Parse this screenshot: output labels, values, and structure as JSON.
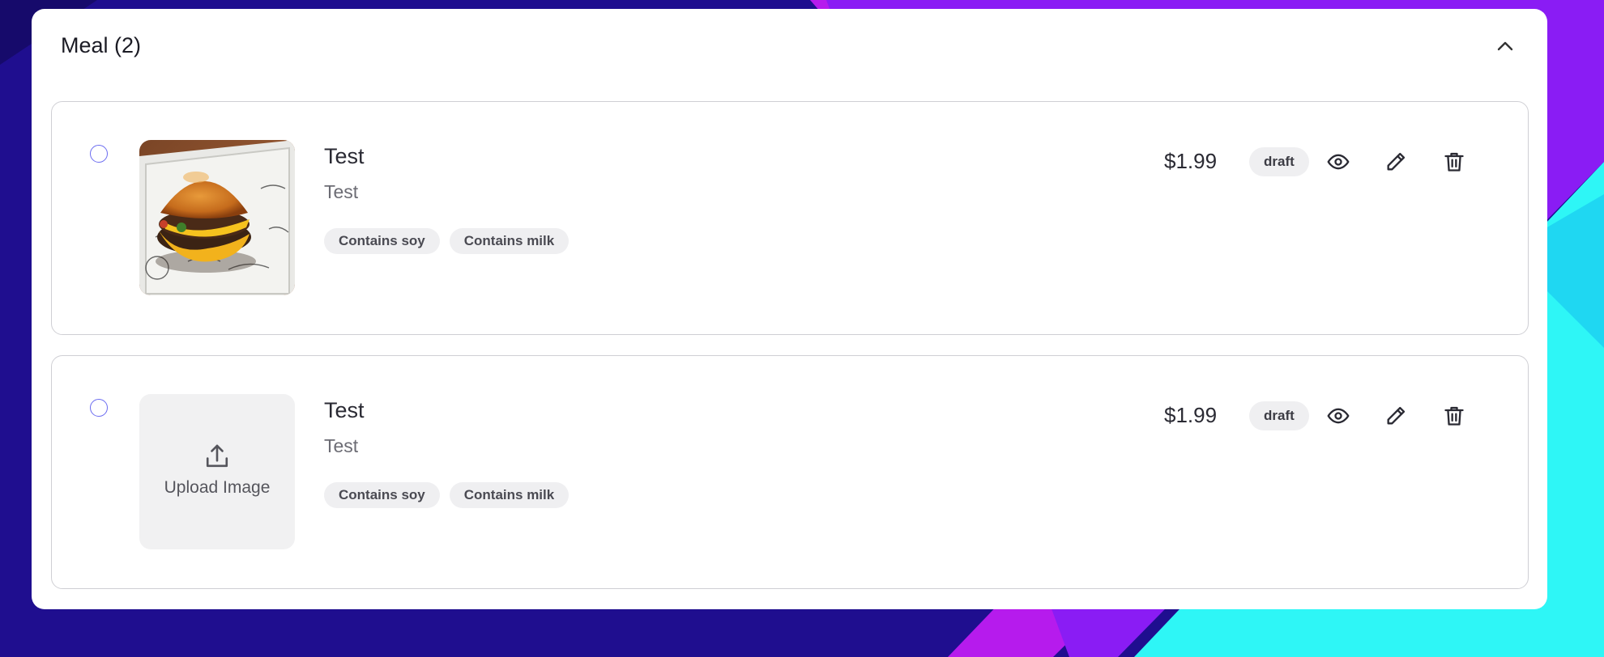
{
  "section": {
    "title": "Meal (2)",
    "collapse_icon": "chevron-up-icon"
  },
  "items": [
    {
      "name": "Test",
      "description": "Test",
      "tags": [
        "Contains soy",
        "Contains milk"
      ],
      "price": "$1.99",
      "status": "draft",
      "image": "burger-photo"
    },
    {
      "name": "Test",
      "description": "Test",
      "tags": [
        "Contains soy",
        "Contains milk"
      ],
      "price": "$1.99",
      "status": "draft",
      "upload_label": "Upload Image"
    }
  ],
  "icons": {
    "view": "eye-icon",
    "edit": "pencil-icon",
    "delete": "trash-icon",
    "upload": "upload-icon"
  },
  "colors": {
    "background": "#1e0f8c",
    "accent_cyan": "#2ef2f5",
    "accent_magenta": "#c41cf0",
    "radio_border": "#6b6cf0"
  }
}
